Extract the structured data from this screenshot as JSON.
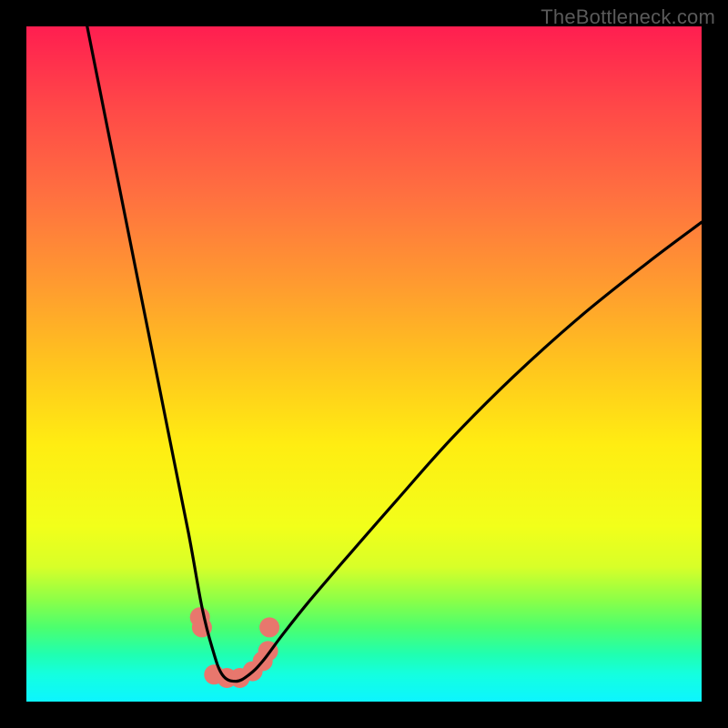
{
  "watermark": "TheBottleneck.com",
  "chart_data": {
    "type": "line",
    "title": "",
    "xlabel": "",
    "ylabel": "",
    "xlim": [
      0,
      100
    ],
    "ylim": [
      0,
      100
    ],
    "grid": false,
    "legend": false,
    "series": [
      {
        "name": "bottleneck-curve",
        "color": "#000000",
        "x": [
          9,
          12,
          15,
          18,
          21,
          24,
          26,
          27.5,
          29,
          31,
          33,
          35,
          38,
          42,
          48,
          55,
          63,
          72,
          82,
          92,
          100
        ],
        "y": [
          100,
          85,
          70,
          55,
          40,
          25,
          14,
          8,
          4,
          3,
          4,
          6,
          10,
          15,
          22,
          30,
          39,
          48,
          57,
          65,
          71
        ]
      },
      {
        "name": "highlight-dots",
        "color": "#e8776d",
        "type": "scatter",
        "x": [
          25.7,
          26.0,
          27.8,
          29.7,
          31.6,
          33.5,
          35.0,
          35.8,
          36.0
        ],
        "y": [
          12.5,
          11.0,
          4.0,
          3.5,
          3.5,
          4.5,
          6.0,
          7.5,
          11.0
        ]
      }
    ]
  }
}
